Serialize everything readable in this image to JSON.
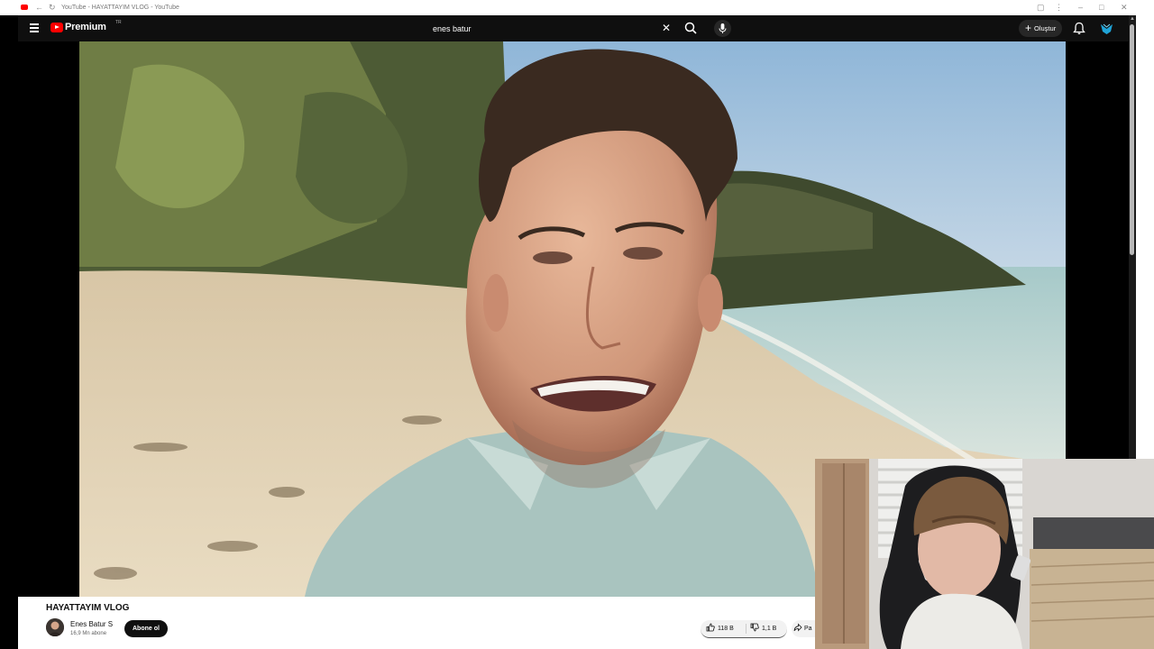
{
  "window": {
    "tab_title": "YouTube - HAYATTAYIM VLOG - YouTube"
  },
  "header": {
    "logo_text": "Premium",
    "country_code": "TR",
    "search_value": "enes batur",
    "create_label": "Oluştur"
  },
  "video": {
    "title": "HAYATTAYIM VLOG"
  },
  "channel": {
    "name": "Enes Batur S",
    "subscribers": "16,9 Mn abone",
    "subscribe_label": "Abone ol"
  },
  "actions": {
    "like_count": "118 B",
    "dislike_count": "1,1 B",
    "share_label": "Pa"
  },
  "colors": {
    "brand_red": "#ff0000",
    "topbar_bg": "#0f0f0f",
    "info_bg": "#ffffff"
  }
}
